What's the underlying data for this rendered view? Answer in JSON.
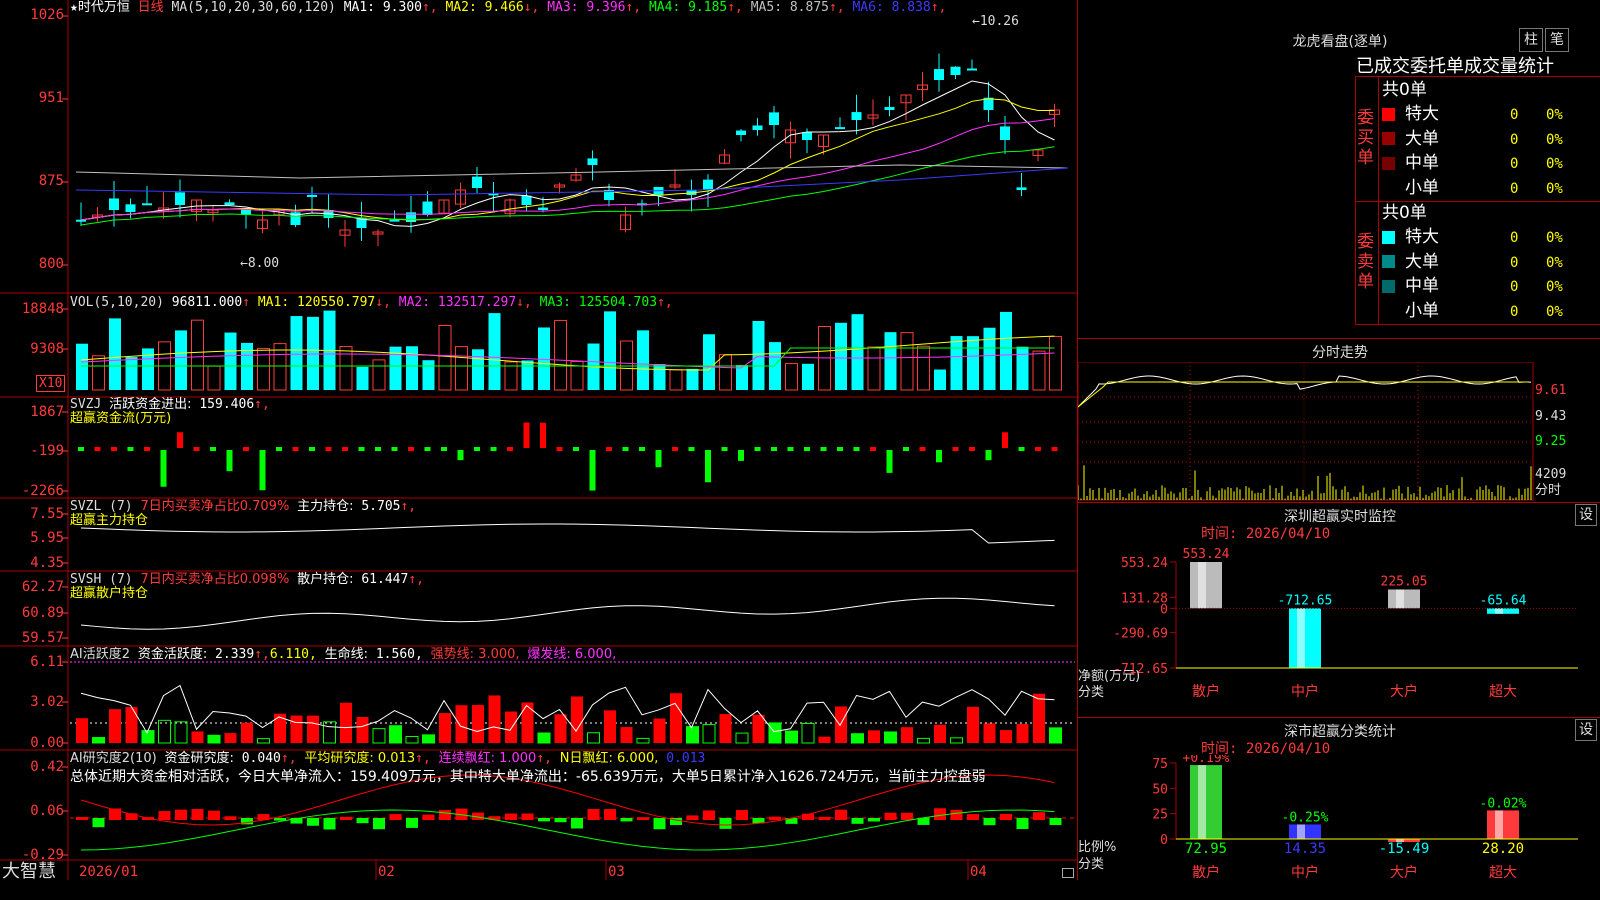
{
  "main": {
    "title_star": "★时代万恒",
    "period": "日线",
    "ma_label": "MA(5,10,20,30,60,120)",
    "ma_values": [
      {
        "name": "MA1:",
        "value": "9.300",
        "arrow": "↑",
        "color": "#ffffff"
      },
      {
        "name": "MA2:",
        "value": "9.466",
        "arrow": "↓",
        "color": "#ffff00"
      },
      {
        "name": "MA3:",
        "value": "9.396",
        "arrow": "↑",
        "color": "#ff33ff"
      },
      {
        "name": "MA4:",
        "value": "9.185",
        "arrow": "↑",
        "color": "#00ff00"
      },
      {
        "name": "MA5:",
        "value": "8.875",
        "arrow": "↑",
        "color": "#c0c0c0"
      },
      {
        "name": "MA6:",
        "value": "8.838",
        "arrow": "↑",
        "color": "#3a3aff"
      }
    ],
    "y_axis": [
      "1026",
      "951",
      "875",
      "800"
    ],
    "high_label": "←10.26",
    "low_label": "←8.00"
  },
  "vol": {
    "label": "VOL(5,10,20)",
    "value": "96811.000",
    "value_arrow": "↑",
    "ma": [
      {
        "name": "MA1:",
        "value": "120550.797",
        "arrow": "↓",
        "color": "#ffff00"
      },
      {
        "name": "MA2:",
        "value": "132517.297",
        "arrow": "↓",
        "color": "#ff33ff"
      },
      {
        "name": "MA3:",
        "value": "125504.703",
        "arrow": "↑",
        "color": "#00ff00"
      }
    ],
    "y_axis": [
      "18848",
      "9308"
    ],
    "unit": "X10"
  },
  "svzj": {
    "label": "SVZJ",
    "desc": "活跃资金进出:",
    "value": "159.406",
    "arrow": "↑,",
    "sub": "超赢资金流(万元)",
    "y_axis": [
      "1867",
      "-199",
      "-2266"
    ]
  },
  "svzl": {
    "label": "SVZL (7)",
    "desc": "7日内买卖净占比0.709%",
    "desc2": "主力持仓:",
    "value": "5.705",
    "arrow": "↑,",
    "sub": "超赢主力持仓",
    "y_axis": [
      "7.55",
      "5.95",
      "4.35"
    ]
  },
  "svsh": {
    "label": "SVSH (7)",
    "desc": "7日内买卖净占比0.098%",
    "desc2": "散户持仓:",
    "value": "61.447",
    "arrow": "↑,",
    "sub": "超赢散户持仓",
    "y_axis": [
      "62.27",
      "60.89",
      "59.57"
    ]
  },
  "ai1": {
    "label": "AI活跃度2",
    "desc": "资金活跃度:",
    "value": "2.339",
    "arrow": "↑,",
    "v2": "6.110,",
    "desc3": "生命线:",
    "v3": "1.560,",
    "strong": "强势线: 3.000,",
    "burst": "爆发线: 6.000,",
    "y_axis": [
      "6.11",
      "3.02",
      "0.00"
    ]
  },
  "ai2": {
    "label": "AI研究度2(10)",
    "desc": "资金研究度:",
    "value": "0.040",
    "arrow": "↑,",
    "avg": "平均研究度: 0.013",
    "avg_arrow": "↑,",
    "red": "连续飘红: 1.000",
    "red_arrow": "↑,",
    "nred": "N日飘红: 6.000,",
    "last": "0.013",
    "summary": "总体近期大资金相对活跃，今日大单净流入：159.409万元，其中特大单净流出：-65.639万元，大单5日累计净入1626.724万元，当前主力控盘弱",
    "y_axis": [
      "0.42",
      "0.06",
      "-0.29"
    ]
  },
  "bottom": {
    "brand": "大智慧",
    "months": [
      "2026/01",
      "02",
      "03",
      "04"
    ]
  },
  "panel_lhb": {
    "title": "龙虎看盘(逐单)",
    "btn1": "柱",
    "btn2": "笔",
    "tabs": [
      "已成交委托单成交量统计"
    ],
    "buy_label": "委买单",
    "sell_label": "委卖单",
    "buy_total": "共0单",
    "sell_total": "共0单",
    "buy_rows": [
      {
        "name": "特大",
        "count": "0",
        "pct": "0%",
        "color": "#ff0000"
      },
      {
        "name": "大单",
        "count": "0",
        "pct": "0%",
        "color": "#990000"
      },
      {
        "name": "中单",
        "count": "0",
        "pct": "0%",
        "color": "#770000"
      },
      {
        "name": "小单",
        "count": "0",
        "pct": "0%",
        "color": "#000000"
      }
    ],
    "sell_rows": [
      {
        "name": "特大",
        "count": "0",
        "pct": "0%",
        "color": "#00ffff"
      },
      {
        "name": "大单",
        "count": "0",
        "pct": "0%",
        "color": "#008b8b"
      },
      {
        "name": "中单",
        "count": "0",
        "pct": "0%",
        "color": "#006b6b"
      },
      {
        "name": "小单",
        "count": "0",
        "pct": "0%",
        "color": "#000000"
      }
    ]
  },
  "panel_fs": {
    "title": "分时走势",
    "y_labels": [
      "9.61",
      "9.43",
      "9.25"
    ],
    "vol_label": "4209",
    "vol_unit": "分时"
  },
  "panel_sz": {
    "title": "深圳超赢实时监控",
    "set": "设",
    "time": "时间: 2026/04/10",
    "y_axis": [
      "553.24",
      "131.28",
      "0",
      "-290.69",
      "-712.65"
    ],
    "y_title": "净额(万元)",
    "x_title": "分类",
    "categories": [
      "散户",
      "中户",
      "大户",
      "超大"
    ],
    "values": [
      "553.24",
      "-712.65",
      "225.05",
      "-65.64"
    ],
    "chart_data": {
      "type": "bar",
      "categories": [
        "散户",
        "中户",
        "大户",
        "超大"
      ],
      "values": [
        553.24,
        -712.65,
        225.05,
        -65.64
      ],
      "ylim": [
        -712.65,
        553.24
      ],
      "ylabel": "净额(万元)",
      "xlabel": "分类"
    }
  },
  "panel_ss": {
    "title": "深市超赢分类统计",
    "set": "设",
    "time": "时间: 2026/04/10",
    "y_axis": [
      "75",
      "50",
      "25",
      "0"
    ],
    "y_title": "比例%",
    "x_title": "分类",
    "categories": [
      "散户",
      "中户",
      "大户",
      "超大"
    ],
    "bar_labels": [
      "+0.19%",
      "-0.25%",
      "",
      "-0.02%"
    ],
    "values": [
      "72.95",
      "14.35",
      "-15.49",
      "28.20"
    ],
    "chart_data": {
      "type": "bar",
      "categories": [
        "散户",
        "中户",
        "大户",
        "超大"
      ],
      "values": [
        72.95,
        14.35,
        -15.49,
        28.2
      ],
      "ylim": [
        0,
        75
      ],
      "ylabel": "比例%",
      "xlabel": "分类"
    }
  }
}
